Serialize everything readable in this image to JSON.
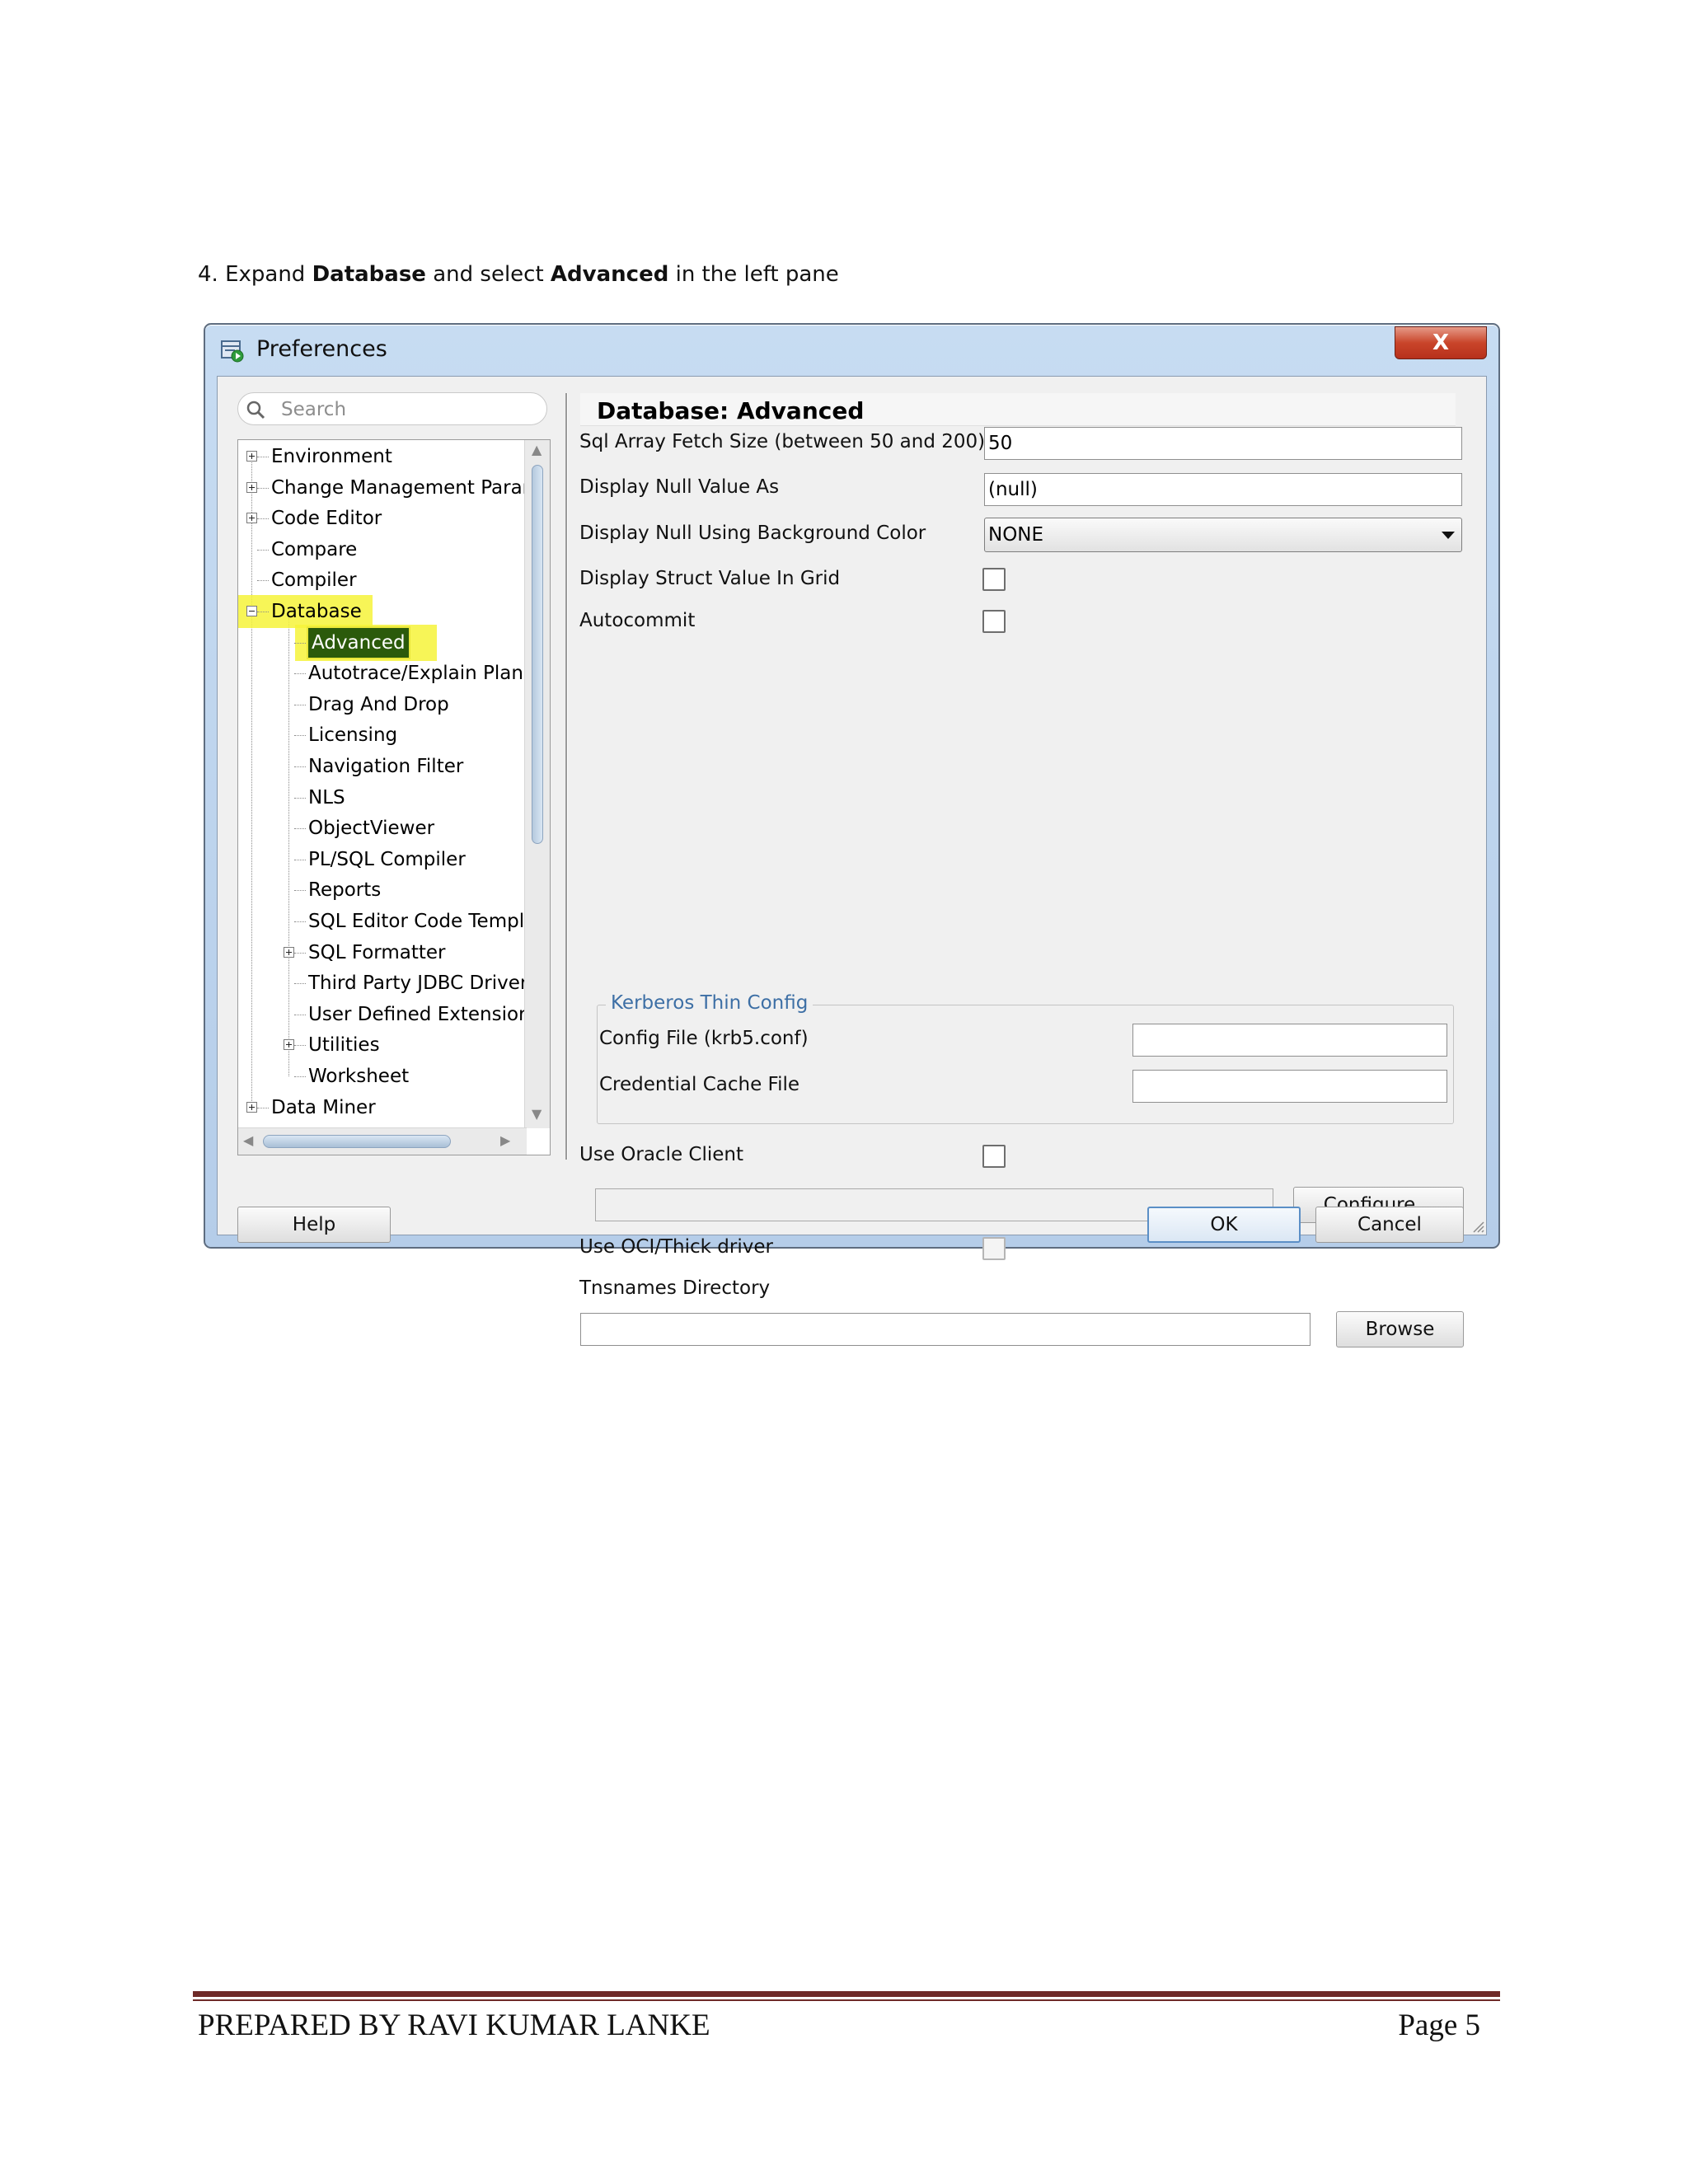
{
  "instruction": {
    "prefix": "4. Expand ",
    "bold1": "Database",
    "middle": " and select ",
    "bold2": "Advanced",
    "suffix": " in the left pane"
  },
  "dialog": {
    "title": "Preferences",
    "close_glyph": "X",
    "search_placeholder": "Search",
    "tree": [
      {
        "label": "Environment",
        "level": 0,
        "expander": "plus"
      },
      {
        "label": "Change Management Parar",
        "level": 0,
        "expander": "plus"
      },
      {
        "label": "Code Editor",
        "level": 0,
        "expander": "plus"
      },
      {
        "label": "Compare",
        "level": 0,
        "expander": "none"
      },
      {
        "label": "Compiler",
        "level": 0,
        "expander": "none"
      },
      {
        "label": "Database",
        "level": 0,
        "expander": "minus",
        "highlight": true
      },
      {
        "label": "Advanced",
        "level": 1,
        "expander": "none",
        "selected": true
      },
      {
        "label": "Autotrace/Explain Plan",
        "level": 1,
        "expander": "none"
      },
      {
        "label": "Drag And Drop",
        "level": 1,
        "expander": "none"
      },
      {
        "label": "Licensing",
        "level": 1,
        "expander": "none"
      },
      {
        "label": "Navigation Filter",
        "level": 1,
        "expander": "none"
      },
      {
        "label": "NLS",
        "level": 1,
        "expander": "none"
      },
      {
        "label": "ObjectViewer",
        "level": 1,
        "expander": "none"
      },
      {
        "label": "PL/SQL Compiler",
        "level": 1,
        "expander": "none"
      },
      {
        "label": "Reports",
        "level": 1,
        "expander": "none"
      },
      {
        "label": "SQL Editor Code Templ",
        "level": 1,
        "expander": "none"
      },
      {
        "label": "SQL Formatter",
        "level": 1,
        "expander": "plus"
      },
      {
        "label": "Third Party JDBC Driver",
        "level": 1,
        "expander": "none"
      },
      {
        "label": "User Defined Extensior",
        "level": 1,
        "expander": "none"
      },
      {
        "label": "Utilities",
        "level": 1,
        "expander": "plus"
      },
      {
        "label": "Worksheet",
        "level": 1,
        "expander": "none"
      },
      {
        "label": "Data Miner",
        "level": 0,
        "expander": "plus"
      }
    ],
    "panel": {
      "title": "Database: Advanced",
      "fetch_size_label": "Sql Array Fetch Size (between 50 and 200)",
      "fetch_size_value": "50",
      "null_value_label": "Display Null Value As",
      "null_value_value": "(null)",
      "null_bg_label": "Display Null Using Background Color",
      "null_bg_value": "NONE",
      "struct_label": "Display Struct Value In Grid",
      "autocommit_label": "Autocommit",
      "kerberos_title": "Kerberos Thin Config",
      "config_file_label": "Config File (krb5.conf)",
      "config_file_value": "",
      "credential_label": "Credential Cache File",
      "credential_value": "",
      "oracle_client_label": "Use Oracle Client",
      "oracle_client_path": "",
      "configure_button": "Configure...",
      "oci_label": "Use OCI/Thick driver",
      "tnsnames_label": "Tnsnames Directory",
      "tnsnames_value": "",
      "browse_button": "Browse"
    },
    "buttons": {
      "help": "Help",
      "ok": "OK",
      "cancel": "Cancel"
    }
  },
  "footer": {
    "left": "PREPARED BY RAVI KUMAR LANKE",
    "right": "Page 5"
  },
  "colors": {
    "selection_bg": "#2b5a0b",
    "highlight": "#f6f33a",
    "footer_rule": "#6e2a28",
    "group_title": "#3d6fa5"
  }
}
